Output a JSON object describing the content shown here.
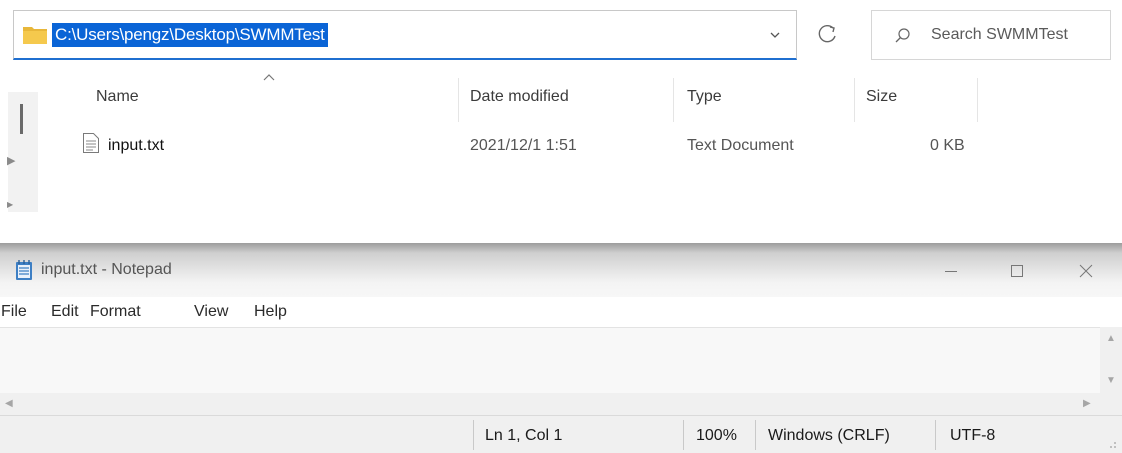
{
  "explorer": {
    "address_path": "C:\\Users\\pengz\\Desktop\\SWMMTest",
    "search_placeholder": "Search SWMMTest",
    "columns": {
      "name": "Name",
      "date_modified": "Date modified",
      "type": "Type",
      "size": "Size"
    },
    "files": [
      {
        "name": "input.txt",
        "date_modified": "2021/12/1 1:51",
        "type": "Text Document",
        "size": "0 KB"
      }
    ]
  },
  "notepad": {
    "title": "input.txt - Notepad",
    "menu": [
      "File",
      "Edit",
      "Format",
      "View",
      "Help"
    ],
    "content": "",
    "status": {
      "position": "Ln 1, Col 1",
      "zoom": "100%",
      "line_ending": "Windows (CRLF)",
      "encoding": "UTF-8"
    }
  },
  "colors": {
    "selection": "#0a64d6",
    "folder": "#e8b73a",
    "accent_border": "#1f6fd0"
  }
}
